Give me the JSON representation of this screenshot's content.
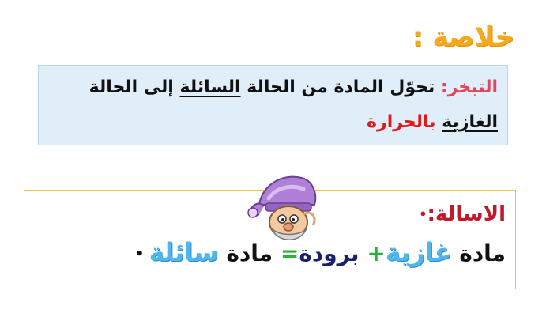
{
  "summary_heading": "خلاصة :",
  "definition": {
    "term": "التبخر:",
    "part1": " تحوّل المادة من الحالة ",
    "liquid": "السائلة",
    "part2": " إلى الحالة ",
    "gas": "الغازية",
    "space": " ",
    "by_heat": "بالحرارة"
  },
  "question": {
    "label": "الاسالة:",
    "bullet": "•",
    "eq_matter1": "مادة ",
    "eq_gaseous": "غازية",
    "eq_plus": "+",
    "eq_cold": " برودة",
    "eq_equals": "=",
    "eq_matter2": " مادة ",
    "eq_liquid": "سائلة",
    "eq_bullet": " •"
  },
  "colors": {
    "heading": "#f6a81e",
    "term": "#e5455a",
    "by_heat": "#e01a1a",
    "question_label": "#c0192b",
    "gas_word": "#4fb6ee",
    "plus": "#27b33a",
    "equals": "#27b33a",
    "box_fill": "#dfeef8",
    "question_border": "#f0c250"
  },
  "icons": [
    "wizard-character-icon"
  ]
}
